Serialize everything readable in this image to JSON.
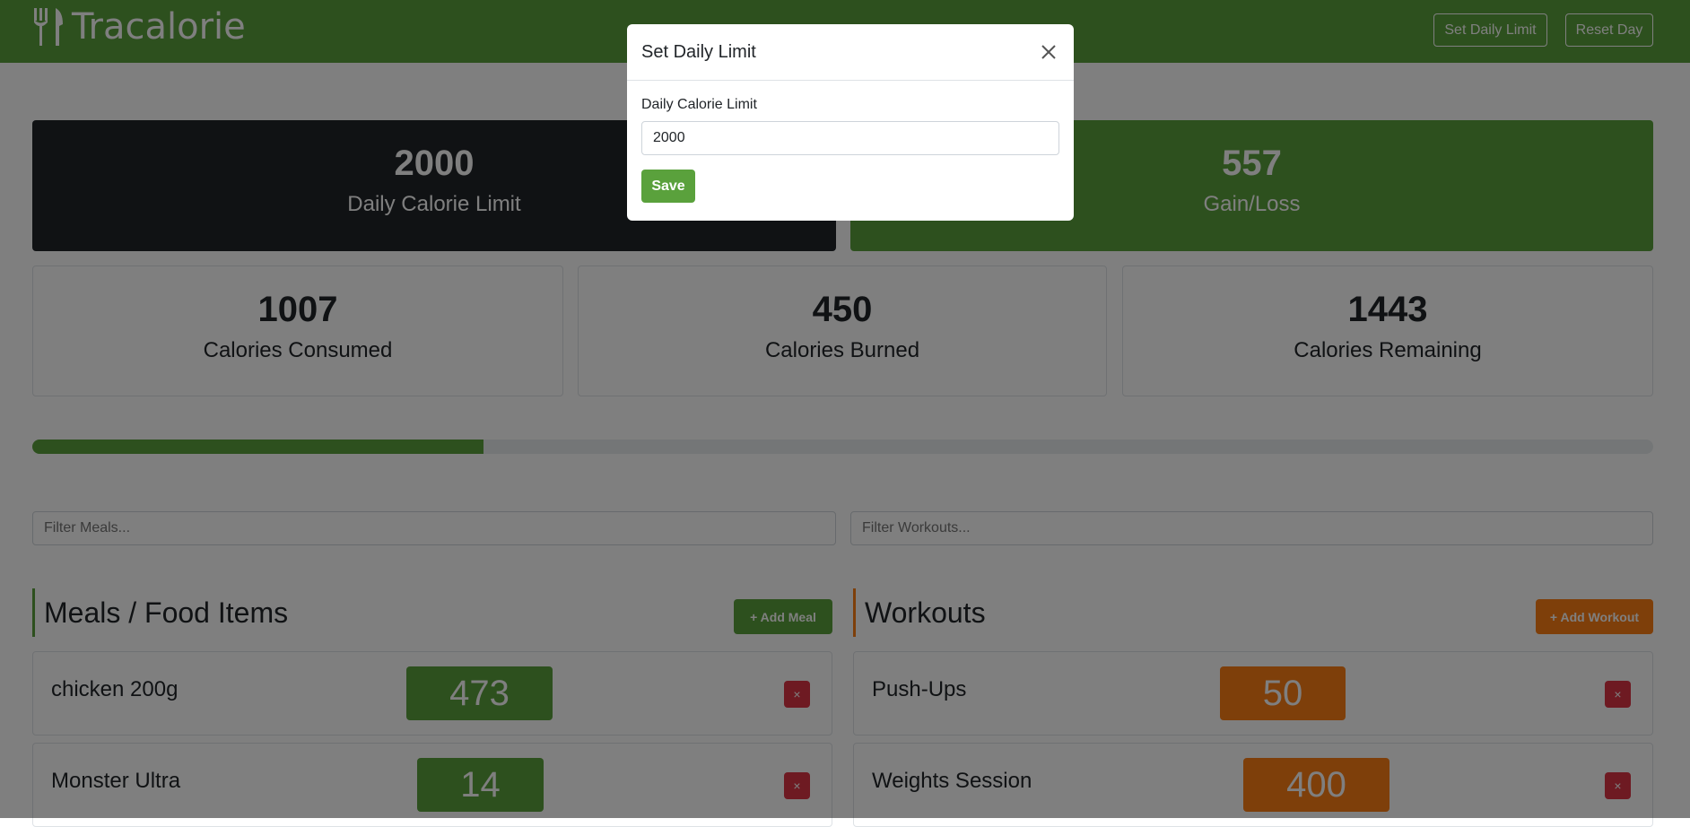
{
  "app": {
    "brand": "Tracalorie",
    "brand_icon": "utensils-icon"
  },
  "nav": {
    "set_limit_label": "Set Daily Limit",
    "reset_label": "Reset Day"
  },
  "summary": {
    "limit_value": "2000",
    "limit_label": "Daily Calorie Limit",
    "gain_value": "557",
    "gain_label": "Gain/Loss"
  },
  "stats": {
    "consumed_value": "1007",
    "consumed_label": "Calories Consumed",
    "burned_value": "450",
    "burned_label": "Calories Burned",
    "remaining_value": "1443",
    "remaining_label": "Calories Remaining"
  },
  "progress": {
    "fraction": 0.2785
  },
  "filters": {
    "meals_placeholder": "Filter Meals...",
    "workouts_placeholder": "Filter Workouts..."
  },
  "meals": {
    "title": "Meals / Food Items",
    "add_label": "+ Add Meal",
    "items": [
      {
        "name": "chicken 200g",
        "calories": "473"
      },
      {
        "name": "Monster Ultra",
        "calories": "14"
      }
    ]
  },
  "workouts": {
    "title": "Workouts",
    "add_label": "+ Add Workout",
    "items": [
      {
        "name": "Push-Ups",
        "calories": "50"
      },
      {
        "name": "Weights Session",
        "calories": "400"
      }
    ]
  },
  "modal": {
    "title": "Set Daily Limit",
    "field_label": "Daily Calorie Limit",
    "field_value": "2000",
    "save_label": "Save"
  },
  "colors": {
    "brand_green": "#5aa13c",
    "dark": "#212529",
    "orange": "#fd7e14",
    "danger": "#dc3545",
    "meal_accent": "#5aa13c",
    "workout_accent": "#fd7e14"
  },
  "delete_label": "×"
}
